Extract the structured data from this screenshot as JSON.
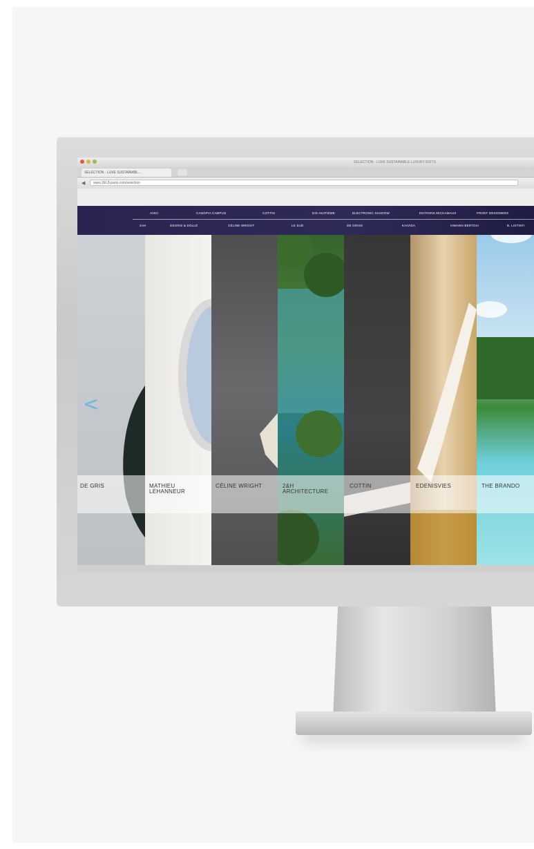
{
  "browser": {
    "window_title": "SELECTION · LUXE SUSTAINABLE LUXURY EDITS",
    "tab_label": "SELECTION · LUXE SUSTAINABL...",
    "url": "www.2EL8-paris.com/selection"
  },
  "nav": {
    "top_row": [
      "AVEC",
      "CANOPIA CAMPUS",
      "COTTIN",
      "DIX-HUITIÈME",
      "ELECTRONIC SHADOW",
      "EDITIONS MICHAMAUX",
      "FRONT DESIGNERS"
    ],
    "bottom_row": [
      "2AH",
      "DEGRIS & DOLLÉ",
      "CÉLINE WRIGHT",
      "LE SUD",
      "DE GRISS",
      "KAIVIDA",
      "HIMANN BERTOIA",
      "B. LISTINTI"
    ]
  },
  "panels": [
    {
      "caption": "DE GRIS",
      "bg": "#c9ccd0"
    },
    {
      "caption": "MATHIEU LEHANNEUR",
      "bg": "#eceae5"
    },
    {
      "caption": "CÉLINE WRIGHT",
      "bg": "#58575a"
    },
    {
      "caption": "2&H ARCHITECTURE",
      "bg": "#3d6b35"
    },
    {
      "caption": "COTTIN",
      "bg": "#3b3b3c"
    },
    {
      "caption": "EDENISVIES",
      "bg": "#c8a878"
    },
    {
      "caption": "THE BRANDO",
      "bg": "#7fcfe0"
    }
  ],
  "controls": {
    "prev_arrow": "<"
  },
  "colors": {
    "nav_bg": "#2a2450",
    "accent_arrow": "#6ab8e0",
    "monitor_silver": "#d0d0d0"
  }
}
